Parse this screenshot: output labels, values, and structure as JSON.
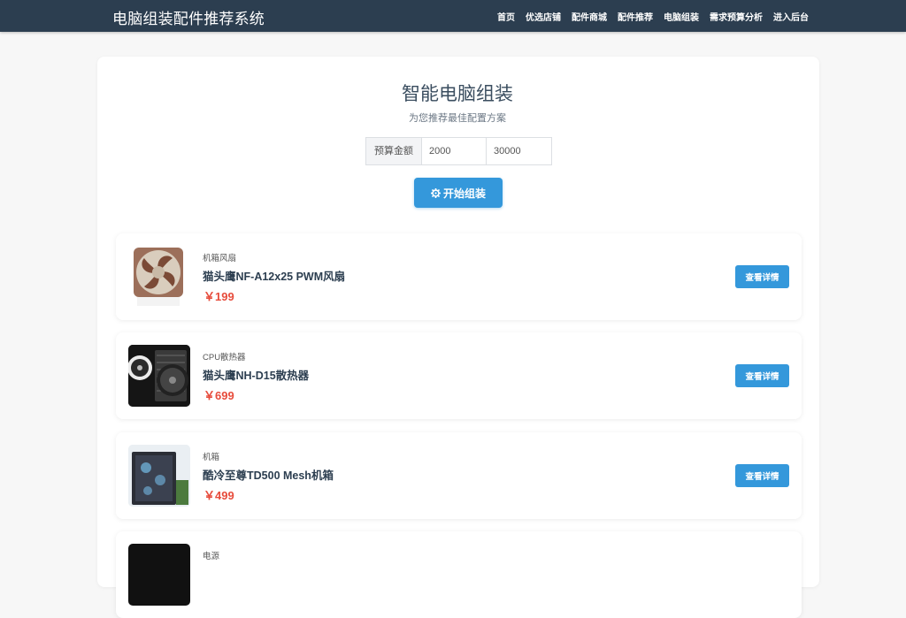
{
  "header": {
    "brand": "电脑组装配件推荐系统",
    "nav": [
      "首页",
      "优选店铺",
      "配件商城",
      "配件推荐",
      "电脑组装",
      "需求预算分析",
      "进入后台"
    ]
  },
  "hero": {
    "title": "智能电脑组装",
    "subtitle": "为您推荐最佳配置方案",
    "budget_label": "预算金额",
    "budget_min": "2000",
    "budget_max": "30000",
    "start_button": "开始组装"
  },
  "products": [
    {
      "category": "机箱风扇",
      "name": "猫头鹰NF-A12x25 PWM风扇",
      "price": "￥199",
      "button": "查看详情",
      "image": "fan-image"
    },
    {
      "category": "CPU散热器",
      "name": "猫头鹰NH-D15散热器",
      "price": "￥699",
      "button": "查看详情",
      "image": "cooler-image"
    },
    {
      "category": "机箱",
      "name": "酷冷至尊TD500 Mesh机箱",
      "price": "￥499",
      "button": "查看详情",
      "image": "case-image"
    },
    {
      "category": "电源",
      "name": "",
      "price": "",
      "button": "",
      "image": "psu-image"
    }
  ],
  "colors": {
    "navbar": "#2c3e50",
    "accent": "#3498db",
    "price": "#e74c3c"
  }
}
